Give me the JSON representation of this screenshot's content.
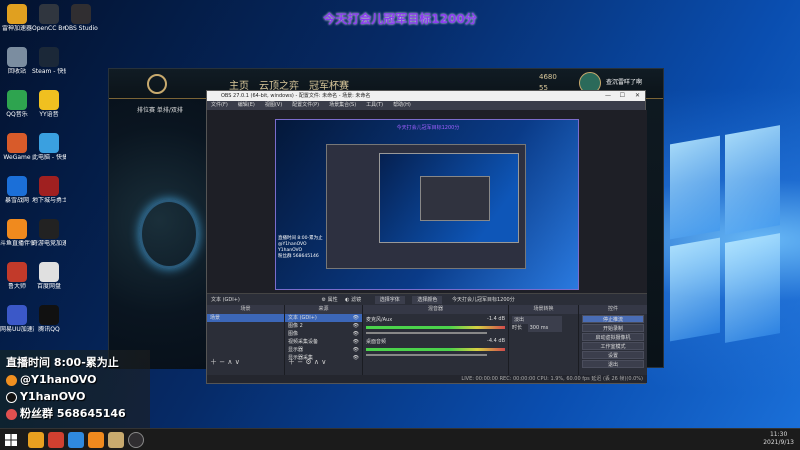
{
  "overlay": {
    "title": "今天打会儿冠军目标1200分"
  },
  "desktop_icons": {
    "col1": [
      {
        "label": "雷神加速器",
        "icon": "raiden-icon",
        "color": "#e0a020"
      },
      {
        "label": "回收站",
        "icon": "recycle-bin-icon",
        "color": "#7b8da0"
      },
      {
        "label": "QQ音乐",
        "icon": "qq-music-icon",
        "color": "#2ea44f"
      },
      {
        "label": "WeGame",
        "icon": "wegame-icon",
        "color": "#d85b2a"
      },
      {
        "label": "暴雪战网",
        "icon": "battlenet-icon",
        "color": "#1b6fd8"
      },
      {
        "label": "斗鱼直播伴侣",
        "icon": "douyu-companion-icon",
        "color": "#f08a1e"
      },
      {
        "label": "鲁大师",
        "icon": "ludashi-icon",
        "color": "#c23a2a"
      },
      {
        "label": "网易UU加速器",
        "icon": "uu-booster-icon",
        "color": "#3b58c8"
      }
    ],
    "col2": [
      {
        "label": "OpenCC Broadcast...",
        "icon": "opencc-icon",
        "color": "#30363f"
      },
      {
        "label": "Steam - 快捷方式",
        "icon": "steam-icon",
        "color": "#1b2838"
      },
      {
        "label": "YY语音",
        "icon": "yy-icon",
        "color": "#f0c020"
      },
      {
        "label": "此电脑 - 快捷方式",
        "icon": "this-pc-icon",
        "color": "#3aa0e0"
      },
      {
        "label": "地下城与勇士",
        "icon": "dnf-icon",
        "color": "#a02020"
      },
      {
        "label": "奇游电竞加速器",
        "icon": "qiyou-icon",
        "color": "#222"
      },
      {
        "label": "百度网盘",
        "icon": "baidu-icon",
        "color": "#e0e0e0"
      },
      {
        "label": "腾讯QQ",
        "icon": "qq-icon",
        "color": "#111"
      }
    ],
    "col3": [
      {
        "label": "OBS Studio",
        "icon": "obs-icon",
        "color": "#302e31"
      }
    ]
  },
  "lol": {
    "nav_home": "主页",
    "nav_clash": "云顶之弈",
    "nav_worlds": "冠军杯赛",
    "currency_be": "4680",
    "currency_rp": "55",
    "profile_name": "查沉雷咩了啊",
    "queue_label": "排位赛 单排/双排"
  },
  "obs": {
    "window_title": "OBS 27.0.1 (64-bit, windows) - 配置文件: 未命名 - 场景: 未命名",
    "menu": [
      "文件(F)",
      "编辑(E)",
      "视图(V)",
      "配置文件(P)",
      "场景集合(S)",
      "工具(T)",
      "帮助(H)"
    ],
    "source_text": "文本 (GDI+)",
    "attr_btn": "属性",
    "filter_btn": "滤镜",
    "font_btn": "选择字体",
    "edit_btn": "选择颜色",
    "text_value": "今天打会儿冠军目标1200分",
    "dock_scenes": "场景",
    "dock_sources": "来源",
    "dock_mixer": "混音器",
    "dock_transitions": "场景转换",
    "dock_controls": "控件",
    "scene_item": "场景",
    "sources": [
      "文本 (GDI+)",
      "图像 2",
      "图像",
      "视频采集设备",
      "显示器",
      "显示器采集"
    ],
    "mixer_tracks": [
      {
        "name": "麦克风/Aux",
        "level": "-1.4 dB"
      },
      {
        "name": "桌面音频",
        "level": "-4.4 dB"
      }
    ],
    "transition_type": "淡出",
    "transition_duration_label": "时长",
    "transition_duration": "300 ms",
    "controls": [
      "停止推流",
      "开始录制",
      "启动虚拟摄像机",
      "工作室模式",
      "设置",
      "退出"
    ],
    "status": "LIVE: 00:00:00   REC: 00:00:00   CPU: 1.9%, 60.00 fps   延迟 (丢 26 帧)(0.0%)"
  },
  "stream_info": {
    "schedule": "直播时间 8:00-累为止",
    "weibo": "@Y1hanOVO",
    "douyin": "Y1hanOVO",
    "fans": "粉丝群 568645146"
  },
  "taskbar": {
    "time": "11:30",
    "date": "2021/9/13"
  }
}
